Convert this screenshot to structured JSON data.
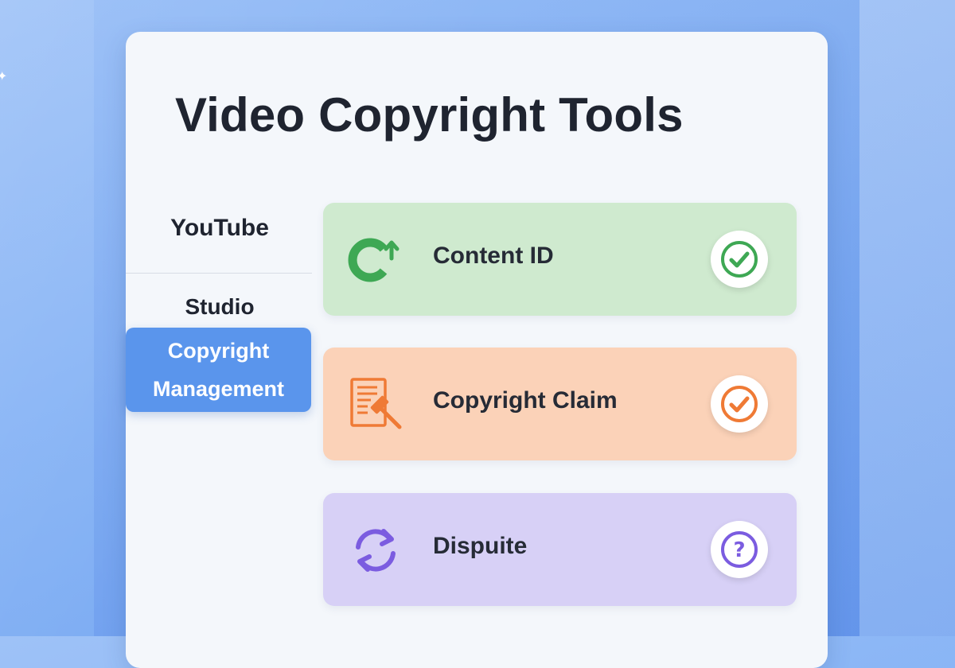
{
  "title": "Video Copyright Tools",
  "sidebar": {
    "items": [
      {
        "label": "YouTube",
        "active": false
      },
      {
        "label": "Studio",
        "active": false
      },
      {
        "label": "Copyright Management",
        "label_lines": [
          "Copyright",
          "Management"
        ],
        "active": true
      }
    ]
  },
  "tools": [
    {
      "label": "Content ID",
      "icon": "content-id-icon",
      "status": "check-icon",
      "color": "#cfeacf",
      "accent": "#3ea854"
    },
    {
      "label": "Copyright Claim",
      "icon": "document-gavel-icon",
      "status": "check-icon",
      "color": "#fbd2b8",
      "accent": "#ef7a35"
    },
    {
      "label": "Dispuite",
      "icon": "refresh-arrows-icon",
      "status": "question-icon",
      "color": "#d7d0f6",
      "accent": "#7b5ce0"
    }
  ],
  "colors": {
    "background": "#86b3f5",
    "active_nav": "#5a95ec"
  }
}
